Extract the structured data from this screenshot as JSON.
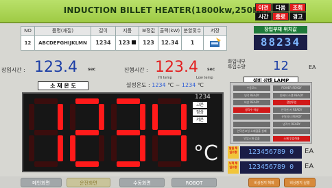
{
  "title": "INDUCTION BILLET HEATER(1800kw,250Hz)",
  "titlebar_buttons": [
    "이전",
    "다음",
    "조회",
    "시간",
    "종료",
    "경고"
  ],
  "info_headers": [
    "NO",
    "품명(재질)",
    "길이",
    "지름",
    "보정값",
    "출력(kW)",
    "분할횟수",
    "저장"
  ],
  "info_values": {
    "no": "12",
    "material": "ABCDEFGHIJKLMN",
    "length": "1234",
    "diameter": "123",
    "correction": "123",
    "output": "12.34",
    "split": "1"
  },
  "clock": {
    "label": "장입부재 위치값",
    "value": "88234"
  },
  "charge_time": {
    "label": "장입시간 :",
    "value": "123.4",
    "unit": "sec"
  },
  "progress_time": {
    "label": "진행시간 :",
    "value": "123.4",
    "unit": "sec"
  },
  "inside_count": {
    "label1": "화입내부",
    "label2": "투입수량",
    "value": "12",
    "unit": "EA"
  },
  "temp_header": "소 재 온 도",
  "set_temp": {
    "label": "설정온도 :",
    "high_label": "Hi temp",
    "low_label": "Low temp",
    "high": "1234",
    "low": "1234",
    "unit": "℃"
  },
  "main_display": {
    "value": "1234",
    "small_value": "1234",
    "buttons": [
      "고온",
      "정상",
      "저온"
    ],
    "unit": "°C"
  },
  "lamp_panel": {
    "title": "설비 상태 LAMP",
    "lamps": [
      {
        "label": "수동모드",
        "red": false
      },
      {
        "label": "POWER READY",
        "red": false
      },
      {
        "label": "냉각 READY",
        "red": false
      },
      {
        "label": "인버터 스탠 READY",
        "red": false
      },
      {
        "label": "비상 READY",
        "red": false
      },
      {
        "label": "전원투입",
        "red": true
      },
      {
        "label": "냉각수 이상",
        "red": true
      },
      {
        "label": "인덕션 커 READY",
        "red": false
      },
      {
        "label": "",
        "red": false
      },
      {
        "label": "유틸리티 READY",
        "red": false
      },
      {
        "label": "",
        "red": false
      },
      {
        "label": "냉각수 READY",
        "red": false
      },
      {
        "label": "인덕션코일 소재검출 실패",
        "red": false
      },
      {
        "label": "",
        "red": false
      },
      {
        "label": "인입소재 검출",
        "red": false
      },
      {
        "label": "소재 투입허용",
        "red": true
      }
    ]
  },
  "counters": [
    {
      "label": "일일\n투입수량",
      "value": "123456789 0",
      "unit": "EA"
    },
    {
      "label": "누적\n투입수량",
      "value": "123456789 0",
      "unit": "EA"
    }
  ],
  "nav": [
    {
      "label": "메인화면",
      "active": false,
      "orange": false
    },
    {
      "label": "운전화면",
      "active": true,
      "orange": false
    },
    {
      "label": "수동화면",
      "active": false,
      "orange": false
    },
    {
      "label": "ROBOT",
      "active": false,
      "orange": false
    },
    {
      "label": "비상정지 해제",
      "active": false,
      "orange": true
    },
    {
      "label": "비상정지 실행",
      "active": false,
      "orange": true
    }
  ],
  "colors": {
    "accent": "#9fcb45",
    "display_bg": "#161616",
    "segment_red": "#ff1a1a"
  }
}
